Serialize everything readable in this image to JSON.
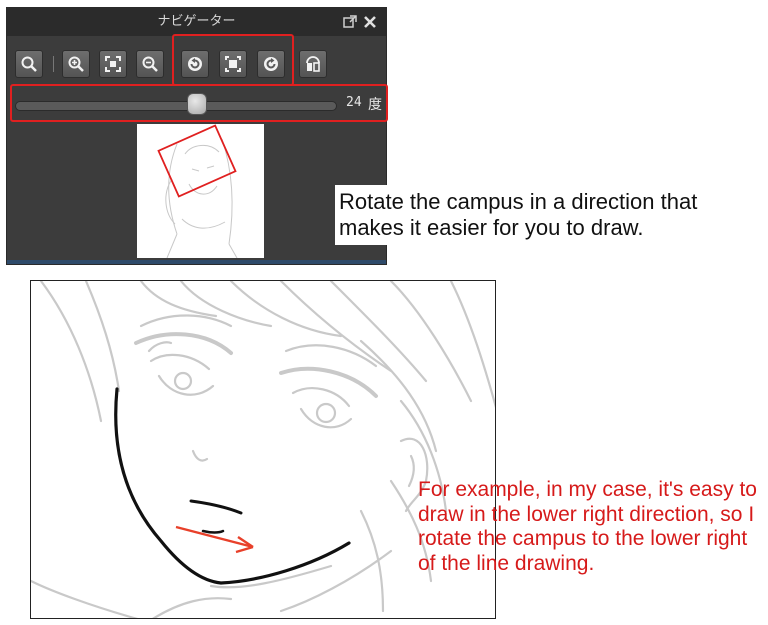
{
  "navigator": {
    "title": "ナビゲーター",
    "angle": {
      "value": "24",
      "unit": "度",
      "slider_fraction": 0.57
    },
    "toolbar": [
      {
        "icon": "zoom-magnifier-icon"
      },
      {
        "icon": "zoom-in-icon"
      },
      {
        "icon": "fit-to-window-icon"
      },
      {
        "icon": "zoom-out-icon"
      },
      {
        "icon": "rotate-left-icon"
      },
      {
        "icon": "reset-rotation-icon"
      },
      {
        "icon": "rotate-right-icon"
      },
      {
        "icon": "flip-horizontal-icon"
      }
    ],
    "colors": {
      "panel": "#3c3c3c",
      "titlebar": "#2b2b2b",
      "highlight": "#e02020"
    }
  },
  "captions": {
    "rotate_tip": "Rotate the campus in a direction that makes it easier for you to draw.",
    "example_tip": "For example, in my case, it's easy to draw in the lower right direction, so I rotate the campus to the lower right of the line drawing."
  },
  "colors": {
    "caption_red": "#d61a1a",
    "arrow_red": "#e8402a"
  }
}
